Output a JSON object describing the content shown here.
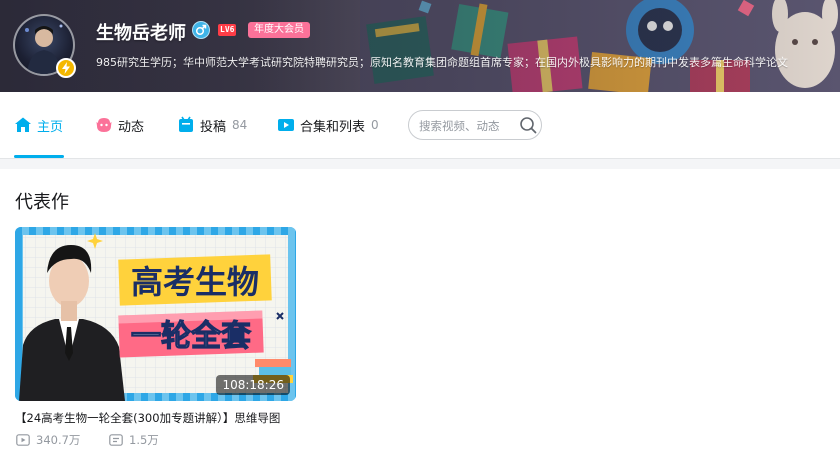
{
  "profile": {
    "name": "生物岳老师",
    "level": "LV6",
    "vip_badge": "年度大会员",
    "bio": "985研究生学历；华中师范大学考试研究院特聘研究员；原知名教育集团命题组首席专家；在国内外极具影响力的期刊中发表多篇生命科学论文"
  },
  "nav": {
    "tabs": [
      {
        "label": "主页",
        "count": "",
        "icon": "home-icon",
        "active": true
      },
      {
        "label": "动态",
        "count": "",
        "icon": "dynamic-icon",
        "active": false
      },
      {
        "label": "投稿",
        "count": "84",
        "icon": "upload-icon",
        "active": false
      },
      {
        "label": "合集和列表",
        "count": "0",
        "icon": "collection-icon",
        "active": false
      }
    ],
    "search_placeholder": "搜索视频、动态"
  },
  "section": {
    "title": "代表作"
  },
  "video": {
    "cover_text_line1": "高考生物",
    "cover_text_line2": "一轮全套",
    "duration": "108:18:26",
    "title": "【24高考生物一轮全套(300加专题讲解）】思维导图",
    "plays": "340.7万",
    "danmaku": "1.5万"
  },
  "colors": {
    "accent": "#00aeec",
    "vip_pink": "#fb7299",
    "level_red": "#ff3d47",
    "cover_blue": "#2ea7e6",
    "cover_yellow": "#ffd23c"
  }
}
